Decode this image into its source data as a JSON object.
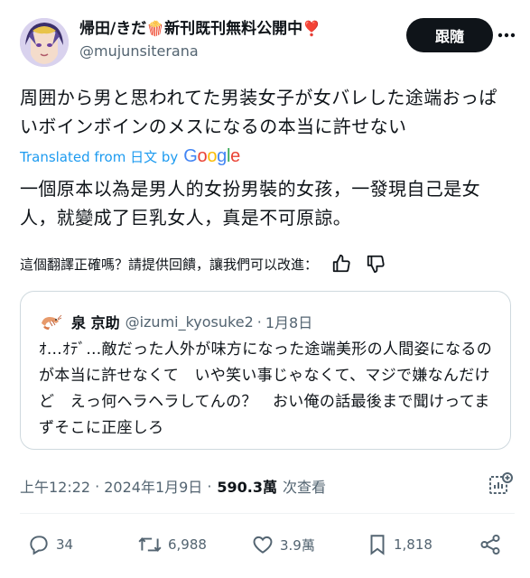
{
  "author": {
    "display_name": "帰田/きだ",
    "name_suffix": "新刊既刊無料公開中",
    "name_emoji_1": "🍿",
    "name_emoji_2": "❣️",
    "handle": "@mujunsiterana"
  },
  "follow_label": "跟隨",
  "tweet_text": "周囲から男と思われてた男装女子が女バレした途端おっぱいボインボインのメスになるの本当に許せない",
  "translated_from": "Translated from 日文 by",
  "google_logo": {
    "letters": [
      "G",
      "o",
      "o",
      "g",
      "l",
      "e"
    ],
    "colors": [
      "#4285F4",
      "#EA4335",
      "#FBBC05",
      "#4285F4",
      "#34A853",
      "#EA4335"
    ]
  },
  "translation_text": "一個原本以為是男人的女扮男裝的女孩，一發現自己是女人，就變成了巨乳女人，真是不可原諒。",
  "feedback_prompt": "這個翻譯正確嗎？請提供回饋，讓我們可以改進：",
  "quote": {
    "avatar_icon": "shrimp-icon",
    "name": "泉 京助",
    "handle": "@izumi_kyosuke2",
    "separator": "·",
    "date": "1月8日",
    "text": "ｵ…ｵﾃﾞ…敵だった人外が味方になった途端美形の人間姿になるのが本当に許せなくて　いや笑い事じゃなくて、マジで嫌なんだけど　えっ何ヘラヘラしてんの？　おい俺の話最後まで聞けってまずそこに正座しろ"
  },
  "meta": {
    "time": "上午12:22",
    "separator": "·",
    "date": "2024年1月9日",
    "separator2": "·",
    "views": "590.3萬",
    "views_label": "次查看"
  },
  "actions": {
    "replies": "34",
    "retweets": "6,988",
    "likes": "3.9萬",
    "bookmarks": "1,818"
  },
  "colors": {
    "text": "#0f1419",
    "secondary": "#536471",
    "link": "#1d9bf0",
    "border": "#cfd9de",
    "follow_bg": "#0f1419"
  }
}
